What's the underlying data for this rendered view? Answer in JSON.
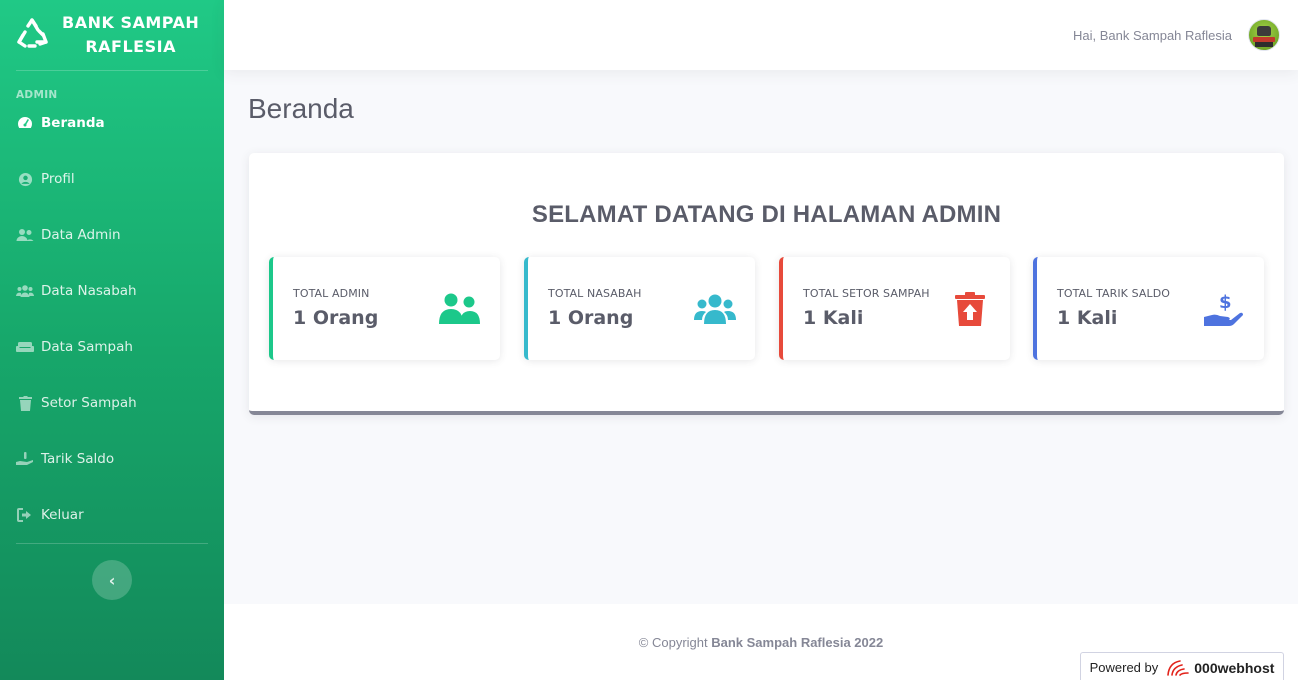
{
  "sidebar": {
    "brand": {
      "line1": "BANK SAMPAH",
      "line2": "RAFLESIA",
      "icon": "recycle-icon"
    },
    "heading": "ADMIN",
    "items": [
      {
        "label": "Beranda",
        "icon": "dashboard-icon",
        "active": true
      },
      {
        "label": "Profil",
        "icon": "user-circle-icon",
        "active": false
      },
      {
        "label": "Data Admin",
        "icon": "user-friends-icon",
        "active": false
      },
      {
        "label": "Data Nasabah",
        "icon": "users-icon",
        "active": false
      },
      {
        "label": "Data Sampah",
        "icon": "couch-icon",
        "active": false
      },
      {
        "label": "Setor Sampah",
        "icon": "trash-icon",
        "active": false
      },
      {
        "label": "Tarik Saldo",
        "icon": "hand-holding-icon",
        "active": false
      },
      {
        "label": "Keluar",
        "icon": "sign-out-icon",
        "active": false
      }
    ],
    "toggle_glyph": "‹"
  },
  "topbar": {
    "greeting": "Hai, Bank Sampah Raflesia",
    "avatar_icon": "avatar-icon"
  },
  "main": {
    "page_title": "Beranda",
    "welcome": "SELAMAT DATANG DI HALAMAN ADMIN",
    "cards": [
      {
        "label": "TOTAL ADMIN",
        "value": "1 Orang",
        "color": "#1cc88a",
        "icon": "user-friends-icon"
      },
      {
        "label": "TOTAL NASABAH",
        "value": "1 Orang",
        "color": "#36b9cc",
        "icon": "users-icon"
      },
      {
        "label": "TOTAL SETOR SAMPAH",
        "value": "1 Kali",
        "color": "#e74a3b",
        "icon": "trash-upload-icon"
      },
      {
        "label": "TOTAL TARIK SALDO",
        "value": "1 Kali",
        "color": "#4e73df",
        "icon": "hand-holding-usd-icon"
      }
    ]
  },
  "footer": {
    "copyright_prefix": "© Copyright",
    "copyright_owner": "Bank Sampah Raflesia 2022",
    "powered_by": "Powered by",
    "host_name": "000webhost"
  }
}
